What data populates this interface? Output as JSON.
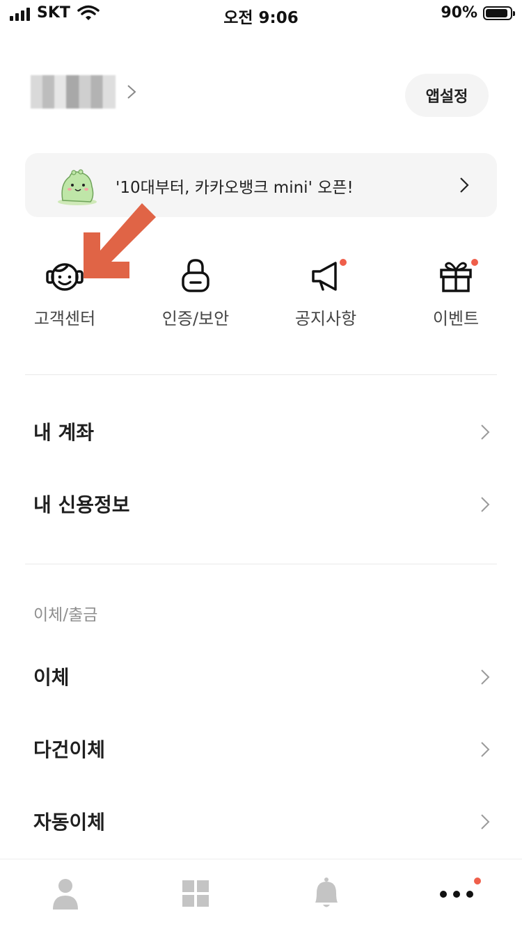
{
  "status_bar": {
    "carrier": "SKT",
    "time": "오전 9:06",
    "battery": "90%",
    "battery_level": 0.9
  },
  "profile": {
    "name": "",
    "app_settings_label": "앱설정"
  },
  "banner": {
    "text": "'10대부터, 카카오뱅크 mini' 오픈!"
  },
  "quick_menu": [
    {
      "label": "고객센터",
      "icon": "headset-face-icon",
      "dot": false
    },
    {
      "label": "인증/보안",
      "icon": "lock-icon",
      "dot": false
    },
    {
      "label": "공지사항",
      "icon": "megaphone-icon",
      "dot": true
    },
    {
      "label": "이벤트",
      "icon": "gift-icon",
      "dot": true
    }
  ],
  "menu": {
    "my_account": "내 계좌",
    "my_credit": "내 신용정보",
    "transfer_section_title": "이체/출금",
    "transfer": "이체",
    "multi_transfer": "다건이체",
    "auto_transfer": "자동이체"
  },
  "tab_bar": [
    {
      "icon": "person-icon"
    },
    {
      "icon": "grid-icon"
    },
    {
      "icon": "bell-icon"
    },
    {
      "icon": "more-icon",
      "dot": true
    }
  ],
  "colors": {
    "accent_dot": "#ef5f4b",
    "annotation_arrow": "#e06446",
    "banner_bg": "#f5f5f5",
    "tab_icon": "#c4c4c4"
  }
}
